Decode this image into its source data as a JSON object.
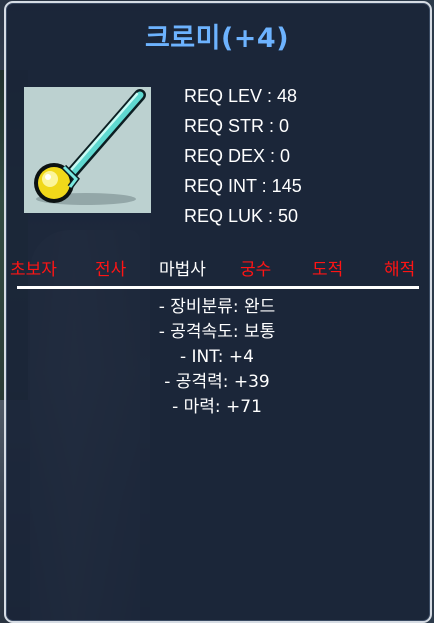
{
  "item": {
    "name": "크로미(+4)",
    "icon": "wand-icon",
    "title_color": "#6db3ff"
  },
  "requirements": [
    {
      "label": "REQ LEV : 48"
    },
    {
      "label": "REQ STR : 0"
    },
    {
      "label": "REQ DEX : 0"
    },
    {
      "label": "REQ INT : 145"
    },
    {
      "label": "REQ LUK : 50"
    }
  ],
  "jobs": [
    {
      "label": "초보자",
      "color": "#ff1414"
    },
    {
      "label": "전사",
      "color": "#ff1414"
    },
    {
      "label": "마법사",
      "color": "#ffffff"
    },
    {
      "label": "궁수",
      "color": "#ff1414"
    },
    {
      "label": "도적",
      "color": "#ff1414"
    },
    {
      "label": "해적",
      "color": "#ff1414"
    }
  ],
  "stats": [
    "- 장비분류: 완드",
    "- 공격속도: 보통",
    "- INT: +4",
    "- 공격력: +39",
    "- 마력: +71"
  ]
}
